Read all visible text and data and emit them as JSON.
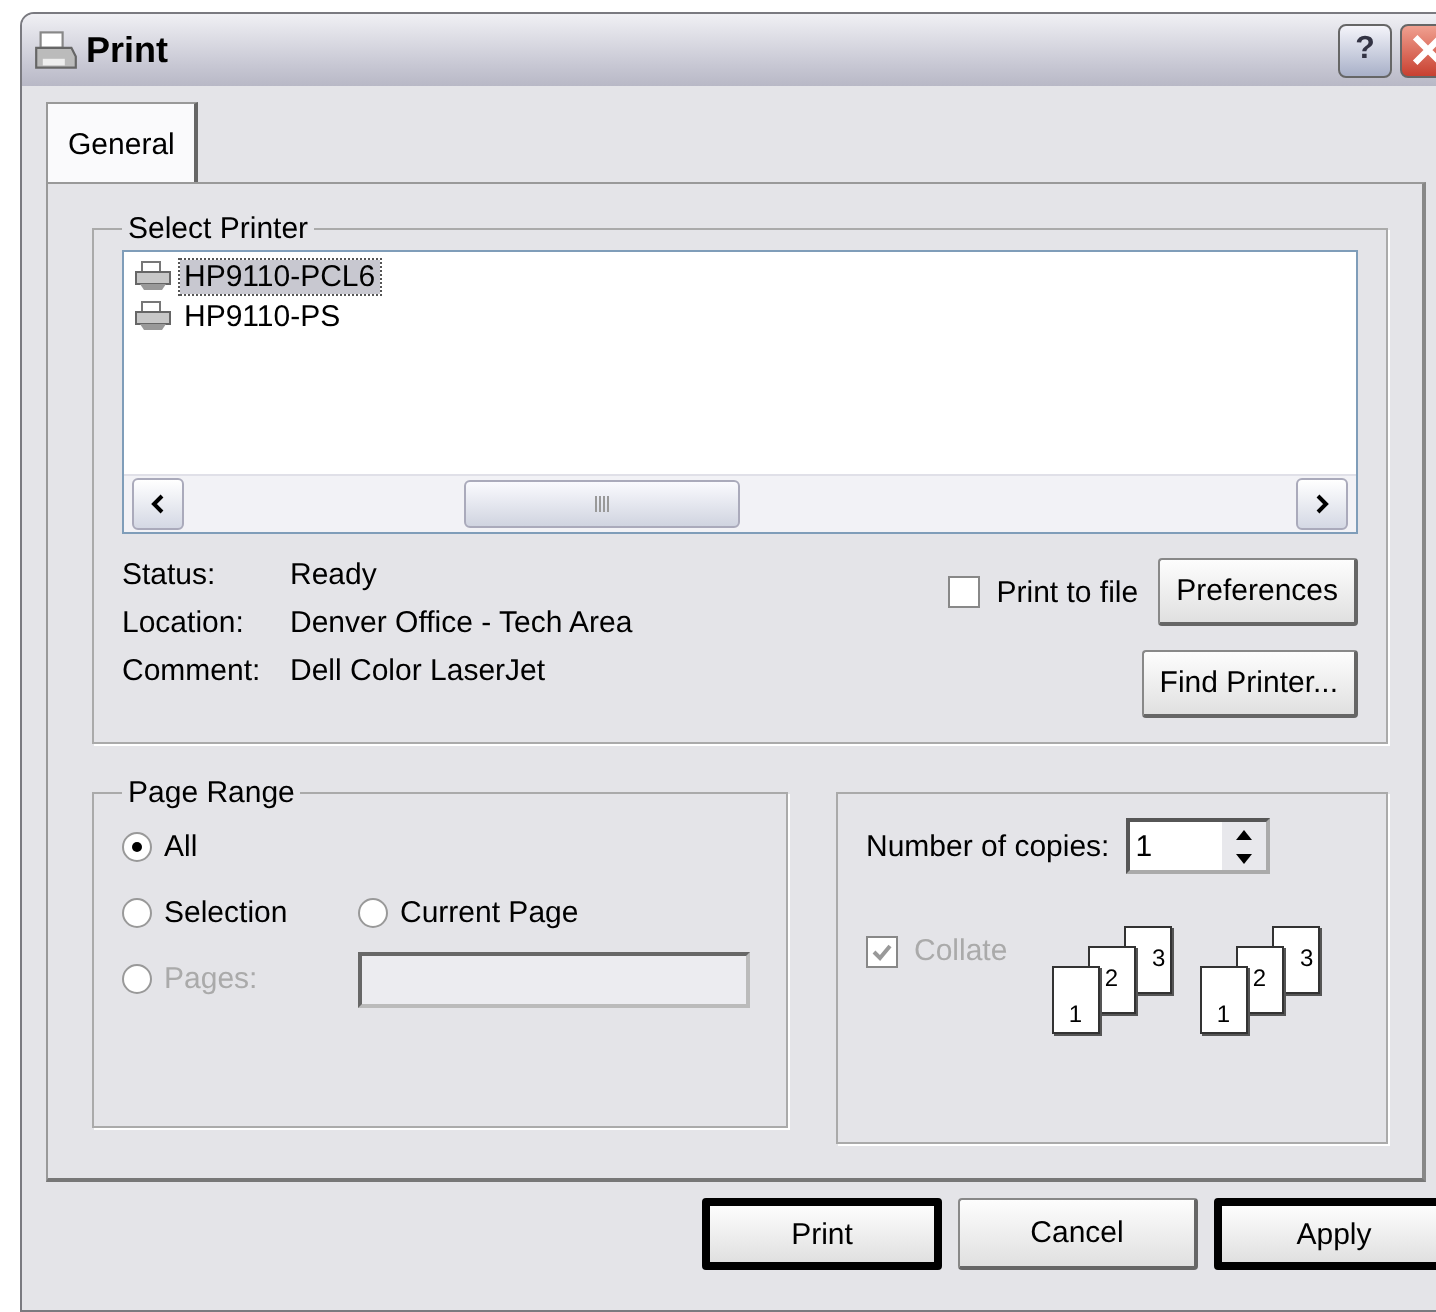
{
  "window": {
    "title": "Print",
    "help_button": "?"
  },
  "tabs": [
    {
      "label": "General",
      "selected": true
    }
  ],
  "select_printer": {
    "legend": "Select Printer",
    "printers": [
      {
        "name": "HP9110-PCL6",
        "selected": true
      },
      {
        "name": "HP9110-PS",
        "selected": false
      }
    ],
    "info": [
      {
        "label": "Status:",
        "value": "Ready"
      },
      {
        "label": "Location:",
        "value": "Denver Office - Tech Area"
      },
      {
        "label": "Comment:",
        "value": "Dell Color LaserJet"
      }
    ],
    "print_to_file": {
      "label": "Print to file",
      "checked": false
    },
    "preferences_button": "Preferences",
    "find_printer_button": "Find Printer..."
  },
  "page_range": {
    "legend": "Page Range",
    "options": [
      {
        "label": "All",
        "selected": true,
        "disabled": false
      },
      {
        "label": "Selection",
        "selected": false,
        "disabled": false
      },
      {
        "label": "Current Page",
        "selected": false,
        "disabled": false
      },
      {
        "label": "Pages:",
        "selected": false,
        "disabled": true
      }
    ]
  },
  "copies": {
    "label": "Number of copies:",
    "value": "1",
    "collate": {
      "label": "Collate",
      "checked": true,
      "disabled": true
    },
    "page_stacks": [
      {
        "numbers": [
          "1",
          "2",
          "3"
        ]
      },
      {
        "numbers": [
          "1",
          "2",
          "3"
        ]
      }
    ]
  },
  "buttons": [
    {
      "label": "Print",
      "highlighted": true
    },
    {
      "label": "Cancel",
      "highlighted": false
    },
    {
      "label": "Apply",
      "highlighted": true
    }
  ]
}
